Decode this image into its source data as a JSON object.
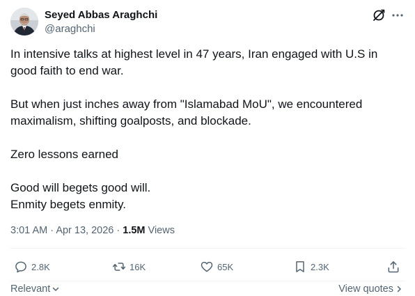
{
  "author": {
    "name": "Seyed Abbas Araghchi",
    "handle": "@araghchi"
  },
  "icons": {
    "grok": "grok-icon",
    "more": "more-icon",
    "reply": "reply-icon",
    "repost": "repost-icon",
    "like": "like-icon",
    "bookmark": "bookmark-icon",
    "share": "share-icon"
  },
  "tweet": {
    "paragraphs": [
      "In intensive talks at highest level in 47 years, Iran engaged with U.S in good faith to end war.",
      "But when just inches away from \"Islamabad MoU\", we encountered maximalism, shifting goalposts, and blockade.",
      "Zero lessons earned",
      "Good will begets good will.\nEnmity begets enmity."
    ]
  },
  "meta": {
    "time": "3:01 AM",
    "date": "Apr 13, 2026",
    "separator": "·",
    "views_count": "1.5M",
    "views_label": "Views"
  },
  "actions": {
    "reply_count": "2.8K",
    "repost_count": "16K",
    "like_count": "65K",
    "bookmark_count": "2.3K"
  },
  "footer": {
    "sort_label": "Relevant",
    "view_quotes_label": "View quotes"
  },
  "colors": {
    "text": "#0f1419",
    "secondary": "#536471",
    "divider": "#eff3f4"
  }
}
